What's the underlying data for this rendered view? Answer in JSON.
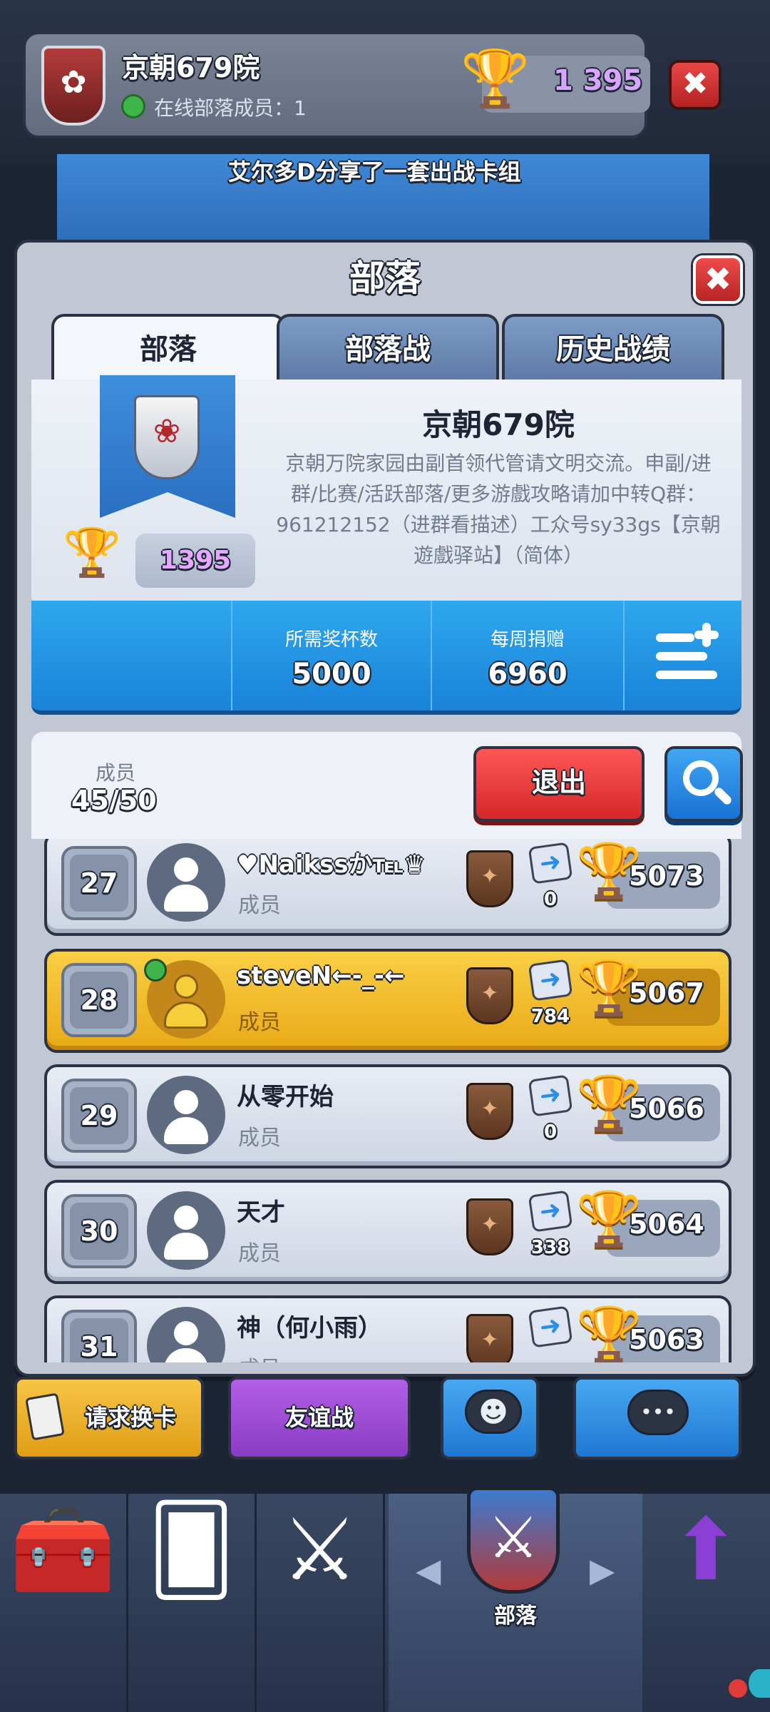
{
  "header": {
    "clan_name": "京朝679院",
    "online_text": "在线部落成员：1",
    "trophies": "1 395",
    "close_glyph": "✖"
  },
  "background_strip": {
    "text": "艾尔多D分享了一套出战卡组"
  },
  "modal": {
    "title": "部落",
    "close_glyph": "✖",
    "tabs": [
      {
        "label": "部落",
        "active": true
      },
      {
        "label": "部落战",
        "active": false
      },
      {
        "label": "历史战绩",
        "active": false
      }
    ]
  },
  "clan_info": {
    "name": "京朝679院",
    "description": "京朝万院家园由副首领代管请文明交流。申副/进群/比赛/活跃部落/更多游戲攻略请加中转Q群：961212152（进群看描述）工众号sy33gs【京朝遊戲驿站】（简体）",
    "trophies": "1395",
    "required_trophies_label": "所需奖杯数",
    "required_trophies": "5000",
    "weekly_donations_label": "每周捐赠",
    "weekly_donations": "6960"
  },
  "members_header": {
    "label": "成员",
    "count": "45/50",
    "leave_label": "退出"
  },
  "members": [
    {
      "rank": "27",
      "name": "♥Naikssか℡♛",
      "role": "成员",
      "donations": "0",
      "trophies": "5073",
      "is_self": false,
      "online": false
    },
    {
      "rank": "28",
      "name": "steveN←-_-←",
      "role": "成员",
      "donations": "784",
      "trophies": "5067",
      "is_self": true,
      "online": true
    },
    {
      "rank": "29",
      "name": "从零开始",
      "role": "成员",
      "donations": "0",
      "trophies": "5066",
      "is_self": false,
      "online": false
    },
    {
      "rank": "30",
      "name": "天才",
      "role": "成员",
      "donations": "338",
      "trophies": "5064",
      "is_self": false,
      "online": false
    },
    {
      "rank": "31",
      "name": "神（何小雨）",
      "role": "成员",
      "donations": "",
      "trophies": "5063",
      "is_self": false,
      "online": false
    }
  ],
  "actions": {
    "request_cards": "请求换卡",
    "friendly_battle": "友谊战"
  },
  "bottom_nav": {
    "active_label": "部落",
    "items": [
      "shop-chest-icon",
      "cards-icon",
      "battle-swords-icon",
      "clan-icon",
      "events-icon"
    ]
  },
  "colors": {
    "accent_blue": "#1983d8",
    "leave_red": "#d52828",
    "self_row_gold": "#e9a917",
    "trophy_purple": "#9b4fd2"
  }
}
